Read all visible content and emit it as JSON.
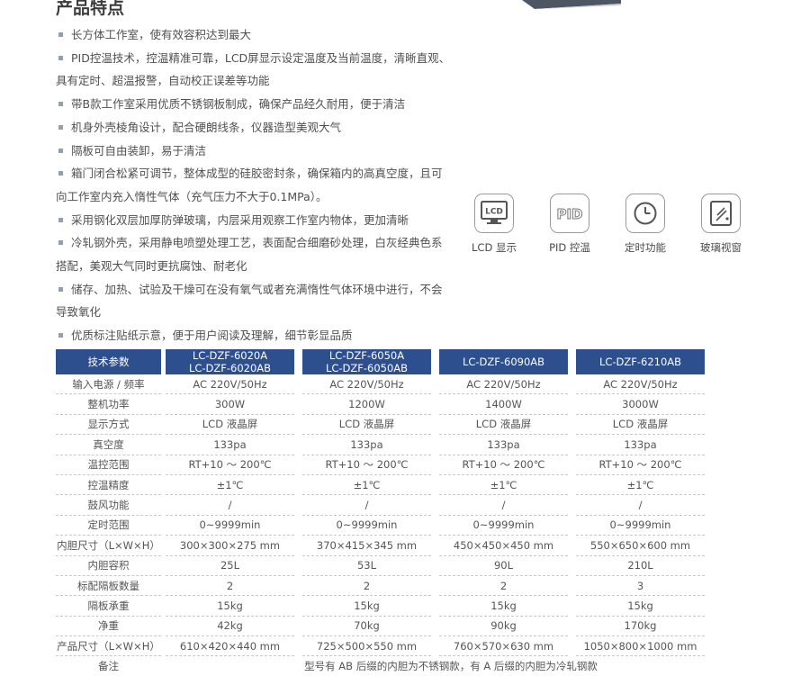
{
  "title": "产品特点",
  "features": [
    {
      "first": "长方体工作室，使有效容积达到最大",
      "cont": ""
    },
    {
      "first": "PID控温技术，控温精准可靠，LCD屏显示设定温度及当前温度，清晰直观、",
      "cont": "具有定时、超温报警，自动校正误差等功能"
    },
    {
      "first": "带B款工作室采用优质不锈钢板制成，确保产品经久耐用，便于清洁",
      "cont": ""
    },
    {
      "first": "机身外壳棱角设计，配合硬朗线条，仪器造型美观大气",
      "cont": ""
    },
    {
      "first": "隔板可自由装卸，易于清洁",
      "cont": ""
    },
    {
      "first": "箱门闭合松紧可调节，整体成型的硅胶密封条，确保箱内的高真空度，且可",
      "cont": "向工作室内充入惰性气体（充气压力不大于0.1MPa）。"
    },
    {
      "first": "采用钢化双层加厚防弹玻璃，内层采用观察工作室内物体，更加清晰",
      "cont": ""
    },
    {
      "first": "冷轧钢外壳，采用静电喷塑处理工艺，表面配合细磨砂处理，白灰经典色系",
      "cont": "搭配，美观大气同时更抗腐蚀、耐老化"
    },
    {
      "first": "储存、加热、试验及干燥可在没有氧气或者充满惰性气体环境中进行，不会",
      "cont": "导致氧化"
    },
    {
      "first": "优质标注贴纸示意，便于用户阅读及理解，细节彰显品质",
      "cont": ""
    }
  ],
  "icons": [
    {
      "name": "lcd-display-icon",
      "glyph": "LCD",
      "label": "LCD 显示"
    },
    {
      "name": "pid-control-icon",
      "glyph": "PID",
      "label": "PID 控温"
    },
    {
      "name": "clock-icon",
      "glyph": "",
      "label": "定时功能"
    },
    {
      "name": "glass-window-icon",
      "glyph": "",
      "label": "玻璃视窗"
    }
  ],
  "table": {
    "header": {
      "param": "技术参数",
      "models": [
        {
          "line1": "LC-DZF-6020A",
          "line2": "LC-DZF-6020AB"
        },
        {
          "line1": "LC-DZF-6050A",
          "line2": "LC-DZF-6050AB"
        },
        {
          "line1": "LC-DZF-6090AB",
          "line2": ""
        },
        {
          "line1": "LC-DZF-6210AB",
          "line2": ""
        }
      ]
    },
    "rows": [
      {
        "label": "输入电源 / 频率",
        "values": [
          "AC 220V/50Hz",
          "AC 220V/50Hz",
          "AC 220V/50Hz",
          "AC 220V/50Hz"
        ]
      },
      {
        "label": "整机功率",
        "values": [
          "300W",
          "1200W",
          "1400W",
          "3000W"
        ]
      },
      {
        "label": "显示方式",
        "values": [
          "LCD 液晶屏",
          "LCD 液晶屏",
          "LCD 液晶屏",
          "LCD 液晶屏"
        ]
      },
      {
        "label": "真空度",
        "values": [
          "133pa",
          "133pa",
          "133pa",
          "133pa"
        ]
      },
      {
        "label": "温控范围",
        "values": [
          "RT+10 ～ 200℃",
          "RT+10 ～ 200℃",
          "RT+10 ～ 200℃",
          "RT+10 ～ 200℃"
        ]
      },
      {
        "label": "控温精度",
        "values": [
          "±1℃",
          "±1℃",
          "±1℃",
          "±1℃"
        ]
      },
      {
        "label": "鼓风功能",
        "values": [
          "/",
          "/",
          "/",
          "/"
        ]
      },
      {
        "label": "定时范围",
        "values": [
          "0~9999min",
          "0~9999min",
          "0~9999min",
          "0~9999min"
        ]
      },
      {
        "label": "内胆尺寸（L×W×H）",
        "values": [
          "300×300×275 mm",
          "370×415×345 mm",
          "450×450×450 mm",
          "550×650×600 mm"
        ]
      },
      {
        "label": "内胆容积",
        "values": [
          "25L",
          "53L",
          "90L",
          "210L"
        ]
      },
      {
        "label": "标配隔板数量",
        "values": [
          "2",
          "2",
          "2",
          "3"
        ]
      },
      {
        "label": "隔板承重",
        "values": [
          "15kg",
          "15kg",
          "15kg",
          "15kg"
        ]
      },
      {
        "label": "净重",
        "values": [
          "42kg",
          "70kg",
          "90kg",
          "170kg"
        ]
      },
      {
        "label": "产品尺寸（L×W×H）",
        "values": [
          "610×420×440 mm",
          "725×500×550 mm",
          "760×570×630 mm",
          "1050×800×1000 mm"
        ]
      }
    ],
    "remark": {
      "label": "备注",
      "text": "型号有 AB 后缀的内胆为不锈钢款，有 A 后缀的内胆为冷轧钢款"
    }
  }
}
